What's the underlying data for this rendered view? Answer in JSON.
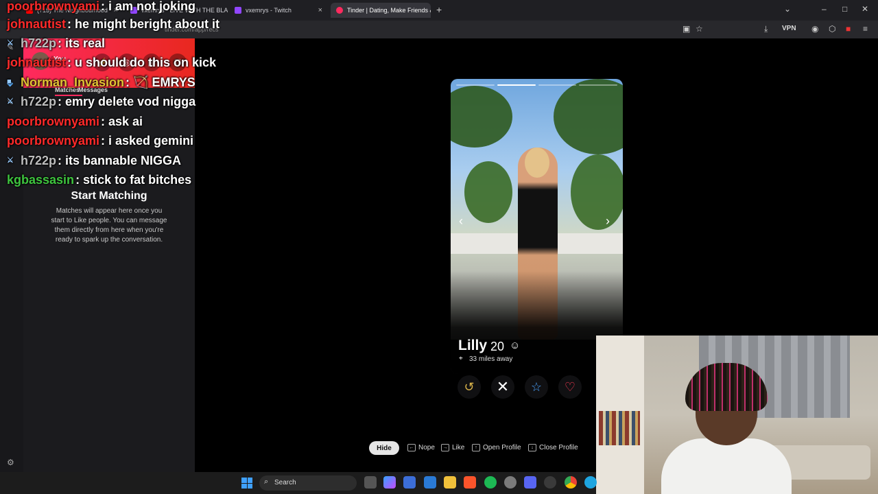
{
  "browser": {
    "tabs": [
      {
        "label": "(715) The Neighbourhood",
        "fav": "#ff0000"
      },
      {
        "label": "vxemrys - LIVE WITH THE BLA...",
        "fav": "#9146ff"
      },
      {
        "label": "vxemrys - Twitch",
        "fav": "#9146ff"
      },
      {
        "label": "Tinder | Dating, Make Friends &",
        "fav": "#ff2a5e"
      }
    ],
    "url": "tinder.com/app/recs",
    "vpn_label": "VPN"
  },
  "sidebar": {
    "you_label": "You",
    "tab_matches": "Matches",
    "tab_messages": "Messages",
    "empty_title": "Start Matching",
    "empty_text": "Matches will appear here once you start to Like people. You can message them directly from here when you're ready to spark up the conversation."
  },
  "profile": {
    "name": "Lilly",
    "age": "20",
    "distance": "33 miles away",
    "photo_count": 4,
    "photo_index": 2
  },
  "hints": {
    "hide": "Hide",
    "nope": "Nope",
    "like": "Like",
    "open_profile": "Open Profile",
    "close_profile": "Close Profile"
  },
  "chat": [
    {
      "user": "poorbrownyami",
      "color": "#ff2a2a",
      "msg": ": i am not joking"
    },
    {
      "user": "johnautist",
      "color": "#ff2a2a",
      "msg": ": he might beright about it"
    },
    {
      "user": "h722p",
      "color": "#bdbdbd",
      "msg": ": its real"
    },
    {
      "user": "johnautist",
      "color": "#ff2a2a",
      "msg": ": u should do this on kick"
    },
    {
      "user": "Norman_Invasion",
      "color": "#e0c233",
      "msg": ": 🏹 EMRYS"
    },
    {
      "user": "h722p",
      "color": "#bdbdbd",
      "msg": ": emry delete vod nigga"
    },
    {
      "user": "poorbrownyami",
      "color": "#ff2a2a",
      "msg": ": ask ai"
    },
    {
      "user": "poorbrownyami",
      "color": "#ff2a2a",
      "msg": ": i asked gemini"
    },
    {
      "user": "h722p",
      "color": "#bdbdbd",
      "msg": ": its bannable NIGGA"
    },
    {
      "user": "kgbassasin",
      "color": "#3ec43e",
      "msg": ": stick to fat bitches"
    }
  ],
  "taskbar": {
    "search_label": "Search"
  }
}
